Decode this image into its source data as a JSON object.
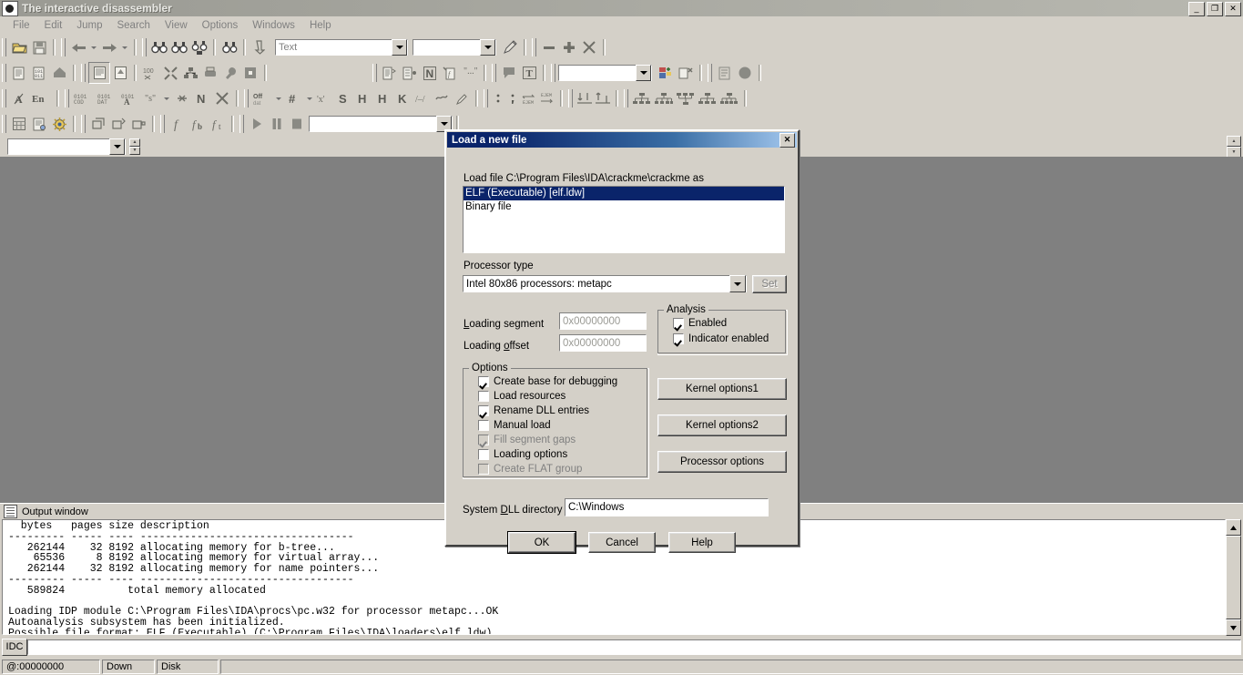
{
  "window": {
    "title": "The interactive disassembler",
    "minimize": "_",
    "restore": "❐",
    "close": "✕"
  },
  "menu": {
    "items": [
      {
        "label": "File"
      },
      {
        "label": "Edit"
      },
      {
        "label": "Jump"
      },
      {
        "label": "Search"
      },
      {
        "label": "View"
      },
      {
        "label": "Options"
      },
      {
        "label": "Windows"
      },
      {
        "label": "Help"
      }
    ]
  },
  "toolbars": {
    "row1": {
      "search_combo_value": "Text",
      "filter_combo_value": ""
    },
    "row2": {
      "jump_combo_value": ""
    },
    "row4": {
      "debugger_combo_value": ""
    }
  },
  "navbar": {
    "combo_value": ""
  },
  "output": {
    "title": "Output window",
    "lines": "  bytes   pages size description\n--------- ----- ---- ----------------------------------\n   262144    32 8192 allocating memory for b-tree...\n    65536     8 8192 allocating memory for virtual array...\n   262144    32 8192 allocating memory for name pointers...\n--------- ----- ---- ----------------------------------\n   589824          total memory allocated\n\nLoading IDP module C:\\Program Files\\IDA\\procs\\pc.w32 for processor metapc...OK\nAutoanalysis subsystem has been initialized.\nPossible file format: ELF (Executable) (C:\\Program Files\\IDA\\loaders\\elf.ldw)"
  },
  "idc": {
    "label": "IDC",
    "value": ""
  },
  "status": {
    "address": "@:00000000",
    "direction": "Down",
    "storage": "Disk",
    "extra": ""
  },
  "dialog": {
    "title": "Load a new file",
    "close_label": "✕",
    "load_file_label": "Load file C:\\Program Files\\IDA\\crackme\\crackme as",
    "loaders": [
      {
        "label": "ELF (Executable) [elf.ldw]",
        "selected": true
      },
      {
        "label": "Binary file",
        "selected": false
      }
    ],
    "processor_type_label": "Processor type",
    "processor_type_value": "Intel 80x86 processors: metapc",
    "set_button": "Set",
    "loading_segment_label": "Loading segment",
    "loading_segment_value": "0x00000000",
    "loading_offset_label": "Loading offset",
    "loading_offset_value": "0x00000000",
    "analysis_group_label": "Analysis",
    "analysis": [
      {
        "label": "Enabled",
        "checked": true,
        "disabled": false
      },
      {
        "label": "Indicator enabled",
        "checked": true,
        "disabled": false
      }
    ],
    "options_group_label": "Options",
    "options": [
      {
        "label": "Create base for debugging",
        "checked": true,
        "disabled": false
      },
      {
        "label": "Load resources",
        "checked": false,
        "disabled": false
      },
      {
        "label": "Rename DLL entries",
        "checked": true,
        "disabled": false
      },
      {
        "label": "Manual load",
        "checked": false,
        "disabled": false
      },
      {
        "label": "Fill segment gaps",
        "checked": true,
        "disabled": true
      },
      {
        "label": "Loading options",
        "checked": false,
        "disabled": false
      },
      {
        "label": "Create FLAT group",
        "checked": false,
        "disabled": true
      }
    ],
    "kernel_options1": "Kernel options1",
    "kernel_options2": "Kernel options2",
    "processor_options": "Processor options",
    "system_dll_label": "System DLL directory",
    "system_dll_value": "C:\\Windows",
    "ok_button": "OK",
    "cancel_button": "Cancel",
    "help_button": "Help"
  },
  "colors": {
    "face": "#d4d0c8",
    "title_active_left": "#0a246a",
    "title_active_right": "#a6caf0",
    "selection": "#0a246a",
    "workspace": "#808080",
    "disabled_text": "#808080"
  }
}
